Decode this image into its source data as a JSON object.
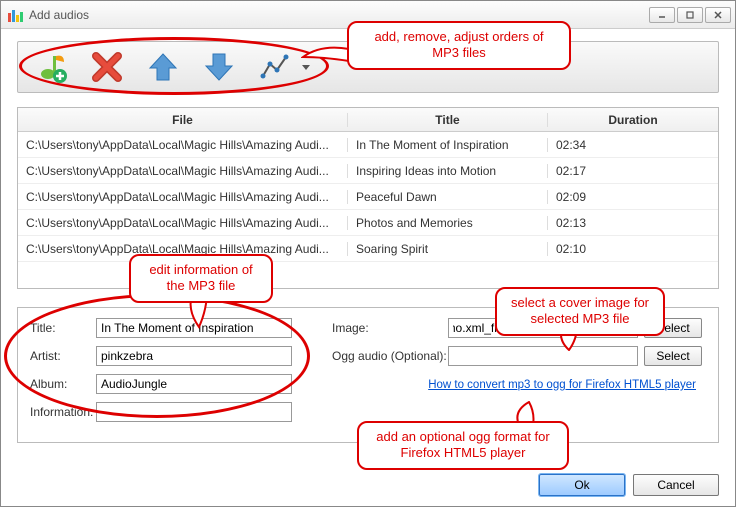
{
  "window": {
    "title": "Add audios"
  },
  "toolbar": {
    "icons": [
      "add-audio-icon",
      "delete-icon",
      "move-up-icon",
      "move-down-icon",
      "chart-icon"
    ]
  },
  "callouts": {
    "toolbar_hint": "add, remove, adjust orders of MP3 files",
    "form_hint": "edit information of the MP3 file",
    "image_hint": "select a cover image for selected MP3 file",
    "ogg_hint": "add an optional ogg format for Firefox HTML5 player"
  },
  "table": {
    "headers": {
      "file": "File",
      "title": "Title",
      "duration": "Duration"
    },
    "rows": [
      {
        "file": "C:\\Users\\tony\\AppData\\Local\\Magic Hills\\Amazing Audi...",
        "title": "In The Moment of Inspiration",
        "duration": "02:34"
      },
      {
        "file": "C:\\Users\\tony\\AppData\\Local\\Magic Hills\\Amazing Audi...",
        "title": "Inspiring Ideas into Motion",
        "duration": "02:17"
      },
      {
        "file": "C:\\Users\\tony\\AppData\\Local\\Magic Hills\\Amazing Audi...",
        "title": "Peaceful Dawn",
        "duration": "02:09"
      },
      {
        "file": "C:\\Users\\tony\\AppData\\Local\\Magic Hills\\Amazing Audi...",
        "title": "Photos and Memories",
        "duration": "02:13"
      },
      {
        "file": "C:\\Users\\tony\\AppData\\Local\\Magic Hills\\Amazing Audi...",
        "title": "Soaring Spirit",
        "duration": "02:10"
      }
    ]
  },
  "form": {
    "labels": {
      "title": "Title:",
      "artist": "Artist:",
      "album": "Album:",
      "info": "Information:",
      "image": "Image:",
      "ogg": "Ogg audio (Optional):"
    },
    "values": {
      "title": "In The Moment of Inspiration",
      "artist": "pinkzebra",
      "album": "AudioJungle",
      "info": "",
      "image": "ect\\demo.xml_files\\golden-wheat-field.jpg",
      "ogg": ""
    },
    "select_btn": "Select",
    "link": "How to convert mp3 to ogg for Firefox HTML5 player"
  },
  "footer": {
    "ok": "Ok",
    "cancel": "Cancel"
  }
}
